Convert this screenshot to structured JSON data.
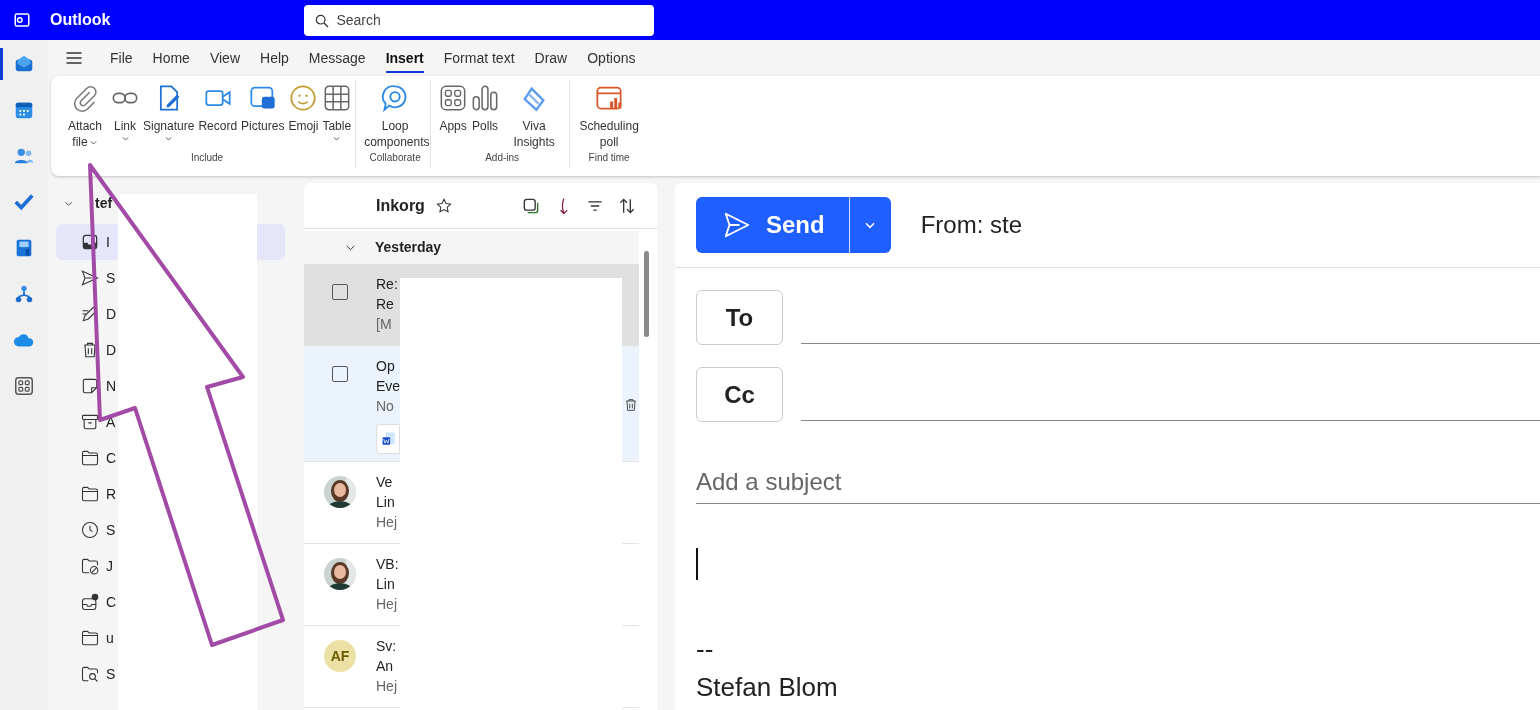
{
  "app": {
    "name": "Outlook"
  },
  "search": {
    "placeholder": "Search"
  },
  "rail": [
    {
      "kind": "mail",
      "selected": true
    },
    {
      "kind": "calendar",
      "selected": false
    },
    {
      "kind": "people",
      "selected": false
    },
    {
      "kind": "todo",
      "selected": false
    },
    {
      "kind": "save",
      "selected": false
    },
    {
      "kind": "org",
      "selected": false
    },
    {
      "kind": "cloud",
      "selected": false
    },
    {
      "kind": "apps",
      "selected": false
    }
  ],
  "menu_tabs": [
    {
      "label": "File",
      "selected": false
    },
    {
      "label": "Home",
      "selected": false
    },
    {
      "label": "View",
      "selected": false
    },
    {
      "label": "Help",
      "selected": false
    },
    {
      "label": "Message",
      "selected": false
    },
    {
      "label": "Insert",
      "selected": true
    },
    {
      "label": "Format text",
      "selected": false
    },
    {
      "label": "Draw",
      "selected": false
    },
    {
      "label": "Options",
      "selected": false
    }
  ],
  "ribbon": {
    "groups": [
      {
        "label": "Include",
        "commands": [
          {
            "label": "Attach file",
            "kind": "attach",
            "dropdown": true,
            "chevron_inline": true
          },
          {
            "label": "Link",
            "kind": "link",
            "dropdown": true
          },
          {
            "label": "Signature",
            "kind": "signature",
            "dropdown": true
          },
          {
            "label": "Record",
            "kind": "record"
          },
          {
            "label": "Pictures",
            "kind": "pictures"
          },
          {
            "label": "Emoji",
            "kind": "emoji"
          },
          {
            "label": "Table",
            "kind": "table",
            "dropdown": true
          }
        ]
      },
      {
        "label": "Collaborate",
        "commands": [
          {
            "label": "Loop components",
            "kind": "loop"
          }
        ]
      },
      {
        "label": "Add-ins",
        "commands": [
          {
            "label": "Apps",
            "kind": "apps"
          },
          {
            "label": "Polls",
            "kind": "polls"
          },
          {
            "label": "Viva Insights",
            "kind": "viva"
          }
        ]
      },
      {
        "label": "Find time",
        "commands": [
          {
            "label": "Scheduling poll",
            "kind": "schedule"
          }
        ]
      }
    ]
  },
  "folders": {
    "account": "tef",
    "expanded": true,
    "items": [
      {
        "label": "I",
        "kind": "inbox",
        "selected": true
      },
      {
        "label": "S",
        "kind": "sent",
        "selected": false
      },
      {
        "label": "D",
        "kind": "drafts",
        "selected": false
      },
      {
        "label": "D",
        "kind": "deleted",
        "selected": false
      },
      {
        "label": "N",
        "kind": "notes",
        "selected": false
      },
      {
        "label": "A",
        "kind": "archive",
        "selected": false
      },
      {
        "label": "C",
        "kind": "folder",
        "selected": false
      },
      {
        "label": "R",
        "kind": "folder",
        "selected": false
      },
      {
        "label": "S",
        "kind": "clock",
        "selected": false
      },
      {
        "label": "J",
        "kind": "junk",
        "selected": false
      },
      {
        "label": "C",
        "kind": "outbox",
        "selected": false
      },
      {
        "label": "u",
        "kind": "folder",
        "selected": false
      },
      {
        "label": "S",
        "kind": "search",
        "selected": false
      }
    ]
  },
  "message_list": {
    "title": "Inkorg",
    "group": {
      "label": "Yesterday",
      "expanded": true
    },
    "messages": [
      {
        "kind": "checkbox",
        "checked": false,
        "selected": false,
        "hovered": true,
        "lines": [
          "Re:",
          "Re",
          "[M"
        ]
      },
      {
        "kind": "checkbox",
        "checked": false,
        "selected": true,
        "hovered": false,
        "attachment": true,
        "delete_action": true,
        "lines": [
          "Op",
          "Eve",
          "No"
        ]
      },
      {
        "selected": false,
        "hovered": false,
        "lines": [
          "Ve",
          "Lin",
          "Hej"
        ]
      },
      {
        "selected": false,
        "hovered": false,
        "lines": [
          "VB:",
          "Lin",
          "Hej"
        ]
      },
      {
        "kind": "initials",
        "initials": "AF",
        "selected": false,
        "hovered": false,
        "lines": [
          "Sv:",
          "An",
          "Hej"
        ]
      }
    ]
  },
  "compose": {
    "send": "Send",
    "from": "From: ste",
    "to": "To",
    "cc": "Cc",
    "subject_placeholder": "Add a subject",
    "body": [
      "--",
      "Stefan Blom"
    ]
  }
}
